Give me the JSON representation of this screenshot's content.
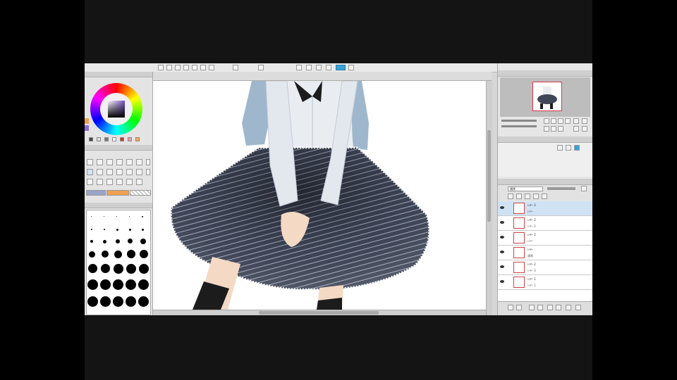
{
  "colors": {
    "background": "#000000",
    "app_chrome": "#d7d7d7",
    "accent": "#38a3d8",
    "skirt": "#3f4658",
    "shirt": "#e9edf2",
    "hair": "#9fb7cc",
    "sock": "#1c1c1c",
    "skin": "#f4d9c4",
    "selected_layer": "#cfe3f5",
    "subcolor_orange": "#f0a050"
  },
  "icons": {
    "eye": "eye-icon",
    "color_wheel": "color-wheel-icon",
    "navigator": "navigator-icon",
    "layer_thumb": "layer-thumbnail-icon"
  },
  "layers": [
    {
      "name": "ﾚｲﾔｰ 2",
      "mode": "ﾚｲﾔｰ",
      "selected": true
    },
    {
      "name": "ﾚｲﾔｰ 2",
      "mode": "ﾚｲﾔｰ 2",
      "selected": false
    },
    {
      "name": "ﾚｲﾔｰ 2",
      "mode": "ﾚｲﾔｰ",
      "selected": false
    },
    {
      "name": "ﾚｲﾔｰ",
      "mode": "通常",
      "selected": false
    },
    {
      "name": "ﾚｲﾔｰ 2",
      "mode": "ﾚｲﾔｰ 3",
      "selected": false
    },
    {
      "name": "ﾚｲﾔｰ 1",
      "mode": "ﾚｲﾔｰ 1",
      "selected": false
    }
  ],
  "layer_panel": {
    "blend_mode": "通常"
  }
}
